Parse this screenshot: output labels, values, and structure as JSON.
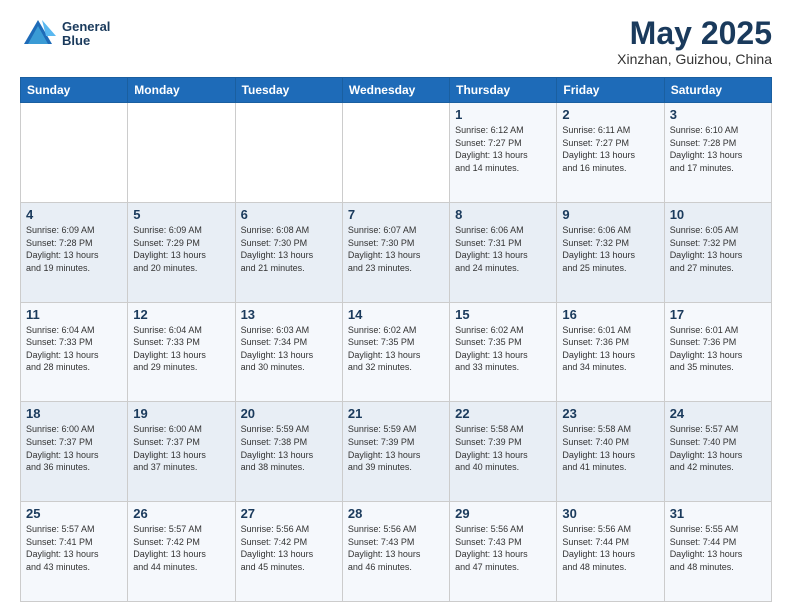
{
  "header": {
    "logo_line1": "General",
    "logo_line2": "Blue",
    "month": "May 2025",
    "location": "Xinzhan, Guizhou, China"
  },
  "weekdays": [
    "Sunday",
    "Monday",
    "Tuesday",
    "Wednesday",
    "Thursday",
    "Friday",
    "Saturday"
  ],
  "weeks": [
    [
      {
        "day": "",
        "info": ""
      },
      {
        "day": "",
        "info": ""
      },
      {
        "day": "",
        "info": ""
      },
      {
        "day": "",
        "info": ""
      },
      {
        "day": "1",
        "info": "Sunrise: 6:12 AM\nSunset: 7:27 PM\nDaylight: 13 hours\nand 14 minutes."
      },
      {
        "day": "2",
        "info": "Sunrise: 6:11 AM\nSunset: 7:27 PM\nDaylight: 13 hours\nand 16 minutes."
      },
      {
        "day": "3",
        "info": "Sunrise: 6:10 AM\nSunset: 7:28 PM\nDaylight: 13 hours\nand 17 minutes."
      }
    ],
    [
      {
        "day": "4",
        "info": "Sunrise: 6:09 AM\nSunset: 7:28 PM\nDaylight: 13 hours\nand 19 minutes."
      },
      {
        "day": "5",
        "info": "Sunrise: 6:09 AM\nSunset: 7:29 PM\nDaylight: 13 hours\nand 20 minutes."
      },
      {
        "day": "6",
        "info": "Sunrise: 6:08 AM\nSunset: 7:30 PM\nDaylight: 13 hours\nand 21 minutes."
      },
      {
        "day": "7",
        "info": "Sunrise: 6:07 AM\nSunset: 7:30 PM\nDaylight: 13 hours\nand 23 minutes."
      },
      {
        "day": "8",
        "info": "Sunrise: 6:06 AM\nSunset: 7:31 PM\nDaylight: 13 hours\nand 24 minutes."
      },
      {
        "day": "9",
        "info": "Sunrise: 6:06 AM\nSunset: 7:32 PM\nDaylight: 13 hours\nand 25 minutes."
      },
      {
        "day": "10",
        "info": "Sunrise: 6:05 AM\nSunset: 7:32 PM\nDaylight: 13 hours\nand 27 minutes."
      }
    ],
    [
      {
        "day": "11",
        "info": "Sunrise: 6:04 AM\nSunset: 7:33 PM\nDaylight: 13 hours\nand 28 minutes."
      },
      {
        "day": "12",
        "info": "Sunrise: 6:04 AM\nSunset: 7:33 PM\nDaylight: 13 hours\nand 29 minutes."
      },
      {
        "day": "13",
        "info": "Sunrise: 6:03 AM\nSunset: 7:34 PM\nDaylight: 13 hours\nand 30 minutes."
      },
      {
        "day": "14",
        "info": "Sunrise: 6:02 AM\nSunset: 7:35 PM\nDaylight: 13 hours\nand 32 minutes."
      },
      {
        "day": "15",
        "info": "Sunrise: 6:02 AM\nSunset: 7:35 PM\nDaylight: 13 hours\nand 33 minutes."
      },
      {
        "day": "16",
        "info": "Sunrise: 6:01 AM\nSunset: 7:36 PM\nDaylight: 13 hours\nand 34 minutes."
      },
      {
        "day": "17",
        "info": "Sunrise: 6:01 AM\nSunset: 7:36 PM\nDaylight: 13 hours\nand 35 minutes."
      }
    ],
    [
      {
        "day": "18",
        "info": "Sunrise: 6:00 AM\nSunset: 7:37 PM\nDaylight: 13 hours\nand 36 minutes."
      },
      {
        "day": "19",
        "info": "Sunrise: 6:00 AM\nSunset: 7:37 PM\nDaylight: 13 hours\nand 37 minutes."
      },
      {
        "day": "20",
        "info": "Sunrise: 5:59 AM\nSunset: 7:38 PM\nDaylight: 13 hours\nand 38 minutes."
      },
      {
        "day": "21",
        "info": "Sunrise: 5:59 AM\nSunset: 7:39 PM\nDaylight: 13 hours\nand 39 minutes."
      },
      {
        "day": "22",
        "info": "Sunrise: 5:58 AM\nSunset: 7:39 PM\nDaylight: 13 hours\nand 40 minutes."
      },
      {
        "day": "23",
        "info": "Sunrise: 5:58 AM\nSunset: 7:40 PM\nDaylight: 13 hours\nand 41 minutes."
      },
      {
        "day": "24",
        "info": "Sunrise: 5:57 AM\nSunset: 7:40 PM\nDaylight: 13 hours\nand 42 minutes."
      }
    ],
    [
      {
        "day": "25",
        "info": "Sunrise: 5:57 AM\nSunset: 7:41 PM\nDaylight: 13 hours\nand 43 minutes."
      },
      {
        "day": "26",
        "info": "Sunrise: 5:57 AM\nSunset: 7:42 PM\nDaylight: 13 hours\nand 44 minutes."
      },
      {
        "day": "27",
        "info": "Sunrise: 5:56 AM\nSunset: 7:42 PM\nDaylight: 13 hours\nand 45 minutes."
      },
      {
        "day": "28",
        "info": "Sunrise: 5:56 AM\nSunset: 7:43 PM\nDaylight: 13 hours\nand 46 minutes."
      },
      {
        "day": "29",
        "info": "Sunrise: 5:56 AM\nSunset: 7:43 PM\nDaylight: 13 hours\nand 47 minutes."
      },
      {
        "day": "30",
        "info": "Sunrise: 5:56 AM\nSunset: 7:44 PM\nDaylight: 13 hours\nand 48 minutes."
      },
      {
        "day": "31",
        "info": "Sunrise: 5:55 AM\nSunset: 7:44 PM\nDaylight: 13 hours\nand 48 minutes."
      }
    ]
  ]
}
